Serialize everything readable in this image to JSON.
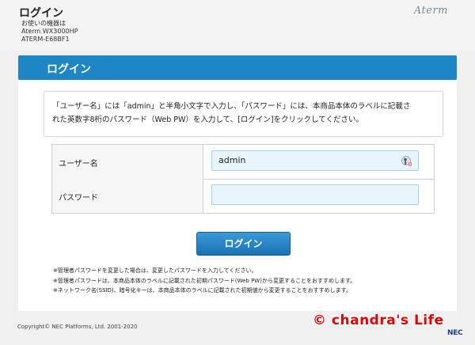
{
  "header": {
    "page_title": "ログイン",
    "device_caption": "お使いの機器は",
    "device_model": "Aterm WX3000HP",
    "device_id": "ATERM-E68BF1",
    "brand_logo": "Aterm"
  },
  "title_bar": {
    "label": "ログイン"
  },
  "instruction": {
    "line1": "「ユーザー名」には「admin」と半角小文字で入力し、「パスワード」には、本商品本体のラベルに記載さ",
    "line2": "れた英数字8桁のパスワード（Web PW）を入力して、[ログイン]をクリックしてください。"
  },
  "form": {
    "username_label": "ユーザー名",
    "username_value": "admin",
    "password_label": "パスワード",
    "password_value": "",
    "key_icon": "key-icon"
  },
  "login_button": {
    "label": "ログイン"
  },
  "notes": [
    "※管理者パスワードを変更した場合は、変更したパスワードを入力してください。",
    "※管理者パスワードは、本商品本体のラベルに記載された初期パスワード(Web PW)から変更することをおすすめします。",
    "※ネットワーク名(SSID)、暗号化キーは、本商品本体のラベルに記載された初期値から変更することをおすすめします。"
  ],
  "footer": {
    "copyright": "Copyright© NEC Platforms, Ltd. 2001-2020",
    "nec_logo": "NEC"
  },
  "watermark": "© chandra's Life",
  "colors": {
    "accent": "#1f86c6",
    "input_bg": "#e9f5fd",
    "watermark": "#e00000"
  }
}
